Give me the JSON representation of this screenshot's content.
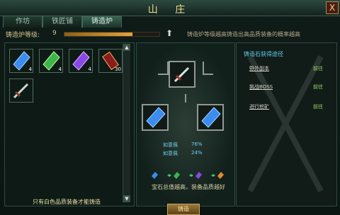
{
  "window": {
    "title": "山 庄",
    "close_label": "X"
  },
  "tabs": [
    "作坊",
    "铁匠铺",
    "铸造炉"
  ],
  "level": {
    "label": "铸造炉等级:",
    "value": "9",
    "progress": 0.72,
    "description": "铸造炉等级越高铸造出高品质装备的概率越高"
  },
  "inventory": {
    "note": "只有白色品质装备才能铸造",
    "slots": [
      {
        "item": "blue-crystal-icon",
        "badge": "4"
      },
      {
        "item": "green-crystal-icon",
        "badge": "4"
      },
      {
        "item": "purple-crystal-icon",
        "badge": "4"
      },
      {
        "item": "red-scroll-icon",
        "badge": "30"
      },
      {
        "item": "sword-icon",
        "badge": ""
      }
    ]
  },
  "forge": {
    "probabilities": [
      {
        "label": "如意佩",
        "value": "76%"
      },
      {
        "label": "如意佩",
        "value": "24%"
      }
    ],
    "value_note": "宝石总值越高，装备品质越好",
    "button": "铸造"
  },
  "sources": {
    "title": "铸造石获得途径",
    "rows": [
      {
        "name": "野外副本",
        "action": "前往"
      },
      {
        "name": "挑战BOSS",
        "action": "前往"
      },
      {
        "name": "进行挖矿",
        "action": "前往"
      }
    ]
  }
}
